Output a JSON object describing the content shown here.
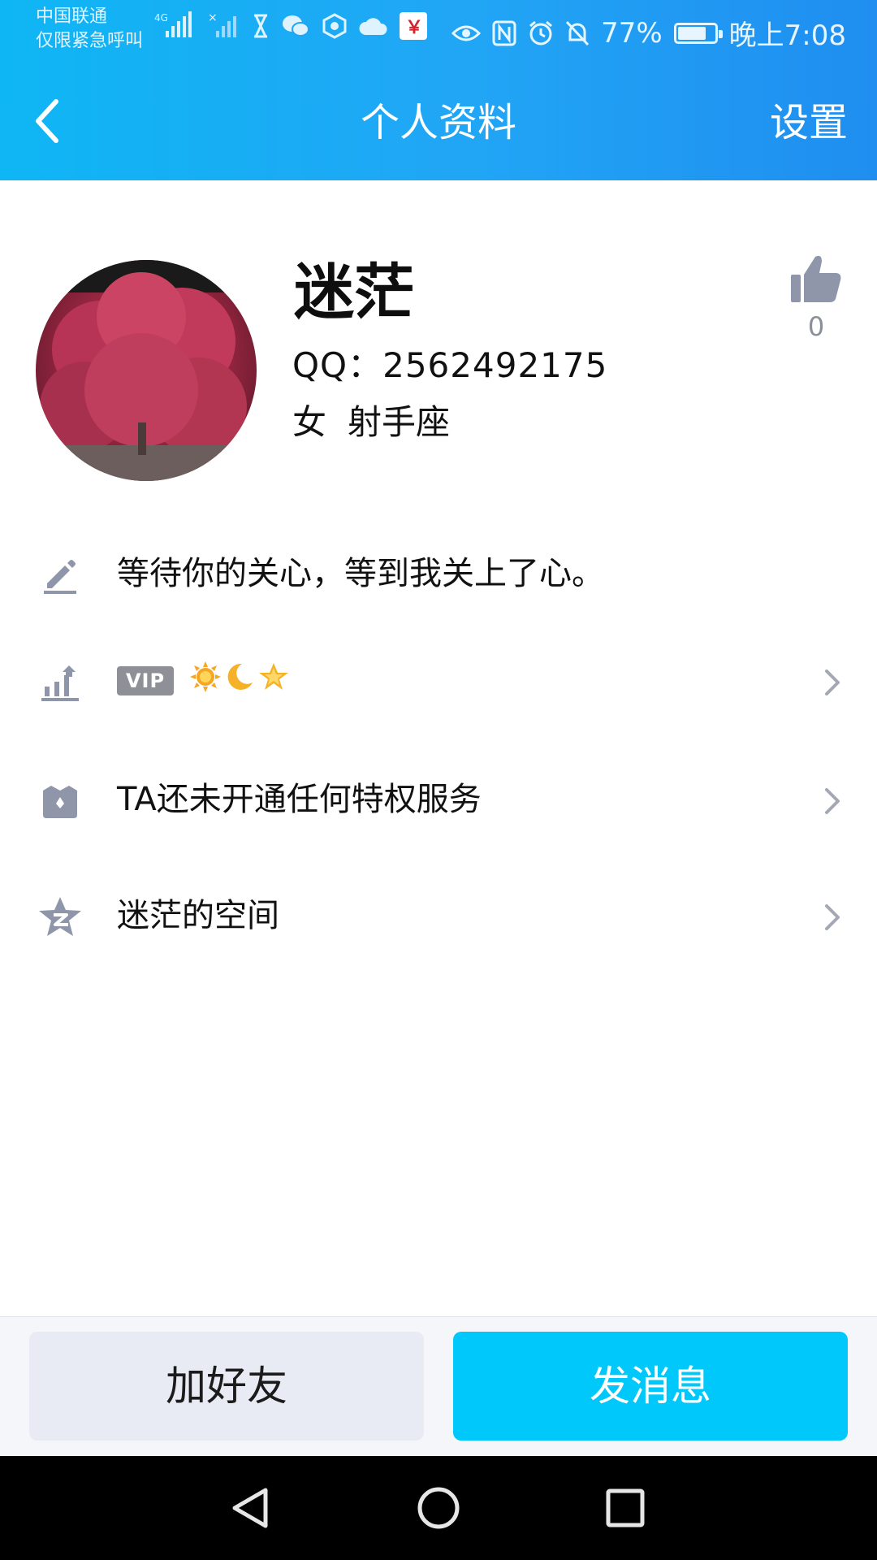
{
  "status_bar": {
    "carrier_line1": "中国联通",
    "carrier_line2": "仅限紧急呼叫",
    "battery_text": "77%",
    "battery_level": 0.77,
    "time": "晚上7:08",
    "icons": [
      "signal-4g-icon",
      "signal-x-icon",
      "hourglass-icon",
      "wechat-icon",
      "app-icon",
      "cloud-icon",
      "bank-icon",
      "eye-icon",
      "nfc-icon",
      "alarm-icon",
      "mute-icon",
      "battery-icon"
    ]
  },
  "nav": {
    "title": "个人资料",
    "settings_label": "设置",
    "back_icon": "chevron-left-icon"
  },
  "profile": {
    "name": "迷茫",
    "qq": "QQ：2562492175",
    "gender": "女",
    "zodiac": "射手座",
    "likes": "0"
  },
  "rows": {
    "signature": {
      "icon": "pencil-icon",
      "text": "等待你的关心，等到我关上了心。"
    },
    "level": {
      "icon": "level-chart-icon",
      "vip_label": "VIP",
      "level_icons": [
        "sun-icon",
        "moon-icon",
        "star-icon"
      ]
    },
    "privilege": {
      "icon": "crown-bag-icon",
      "text": "TA还未开通任何特权服务"
    },
    "space": {
      "icon": "qzone-star-icon",
      "text": "迷茫的空间"
    }
  },
  "actions": {
    "add_friend": "加好友",
    "send_message": "发消息"
  },
  "colors": {
    "header_start": "#0fb6f4",
    "header_end": "#1f8ef0",
    "primary_button": "#00c8fa",
    "secondary_button": "#e9ebf4",
    "icon_gray": "#8f96aa"
  }
}
